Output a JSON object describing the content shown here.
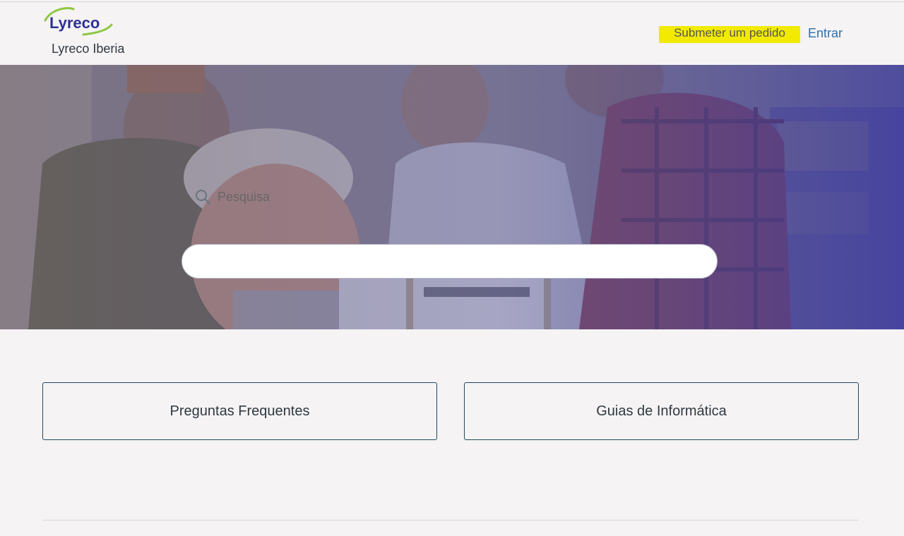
{
  "header": {
    "logo_text": "Lyreco",
    "brand_name": "Lyreco Iberia",
    "nav": {
      "submit_request": "Submeter um pedido",
      "sign_in": "Entrar"
    }
  },
  "hero": {
    "search": {
      "placeholder": "Pesquisa",
      "value": ""
    }
  },
  "categories": [
    {
      "label": "Preguntas Frequentes"
    },
    {
      "label": "Guias de Informática"
    }
  ],
  "icons": {
    "search": "search-icon",
    "logo": "lyreco-logo"
  },
  "colors": {
    "brand_blue": "#2e3192",
    "brand_green": "#8dc63f",
    "highlight": "#f2ea00",
    "link": "#2e6fa8",
    "card_border": "#1f4a5c"
  }
}
